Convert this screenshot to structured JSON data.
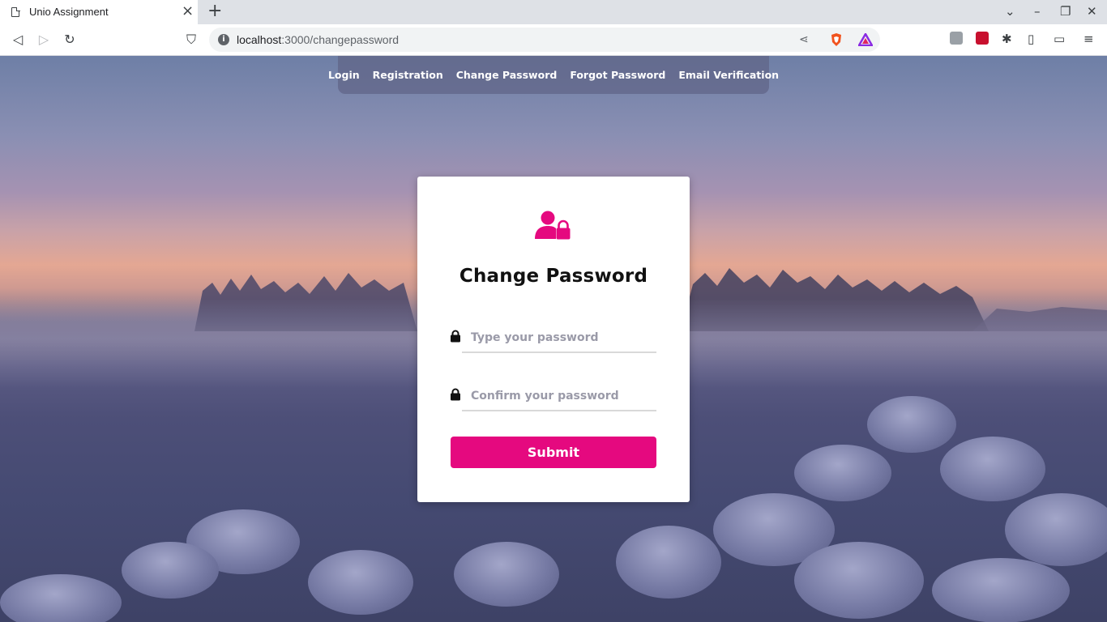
{
  "browser": {
    "tab_title": "Unio Assignment",
    "url_host": "localhost",
    "url_path": ":3000/changepassword"
  },
  "nav": {
    "links": [
      "Login",
      "Registration",
      "Change Password",
      "Forgot Password",
      "Email Verification"
    ]
  },
  "card": {
    "icon": "user-lock-icon",
    "title": "Change Password",
    "password_placeholder": "Type your password",
    "confirm_placeholder": "Confirm your password",
    "submit_label": "Submit"
  },
  "colors": {
    "accent": "#e5097f",
    "nav_background": "#5f6487",
    "card_background": "#ffffff"
  }
}
